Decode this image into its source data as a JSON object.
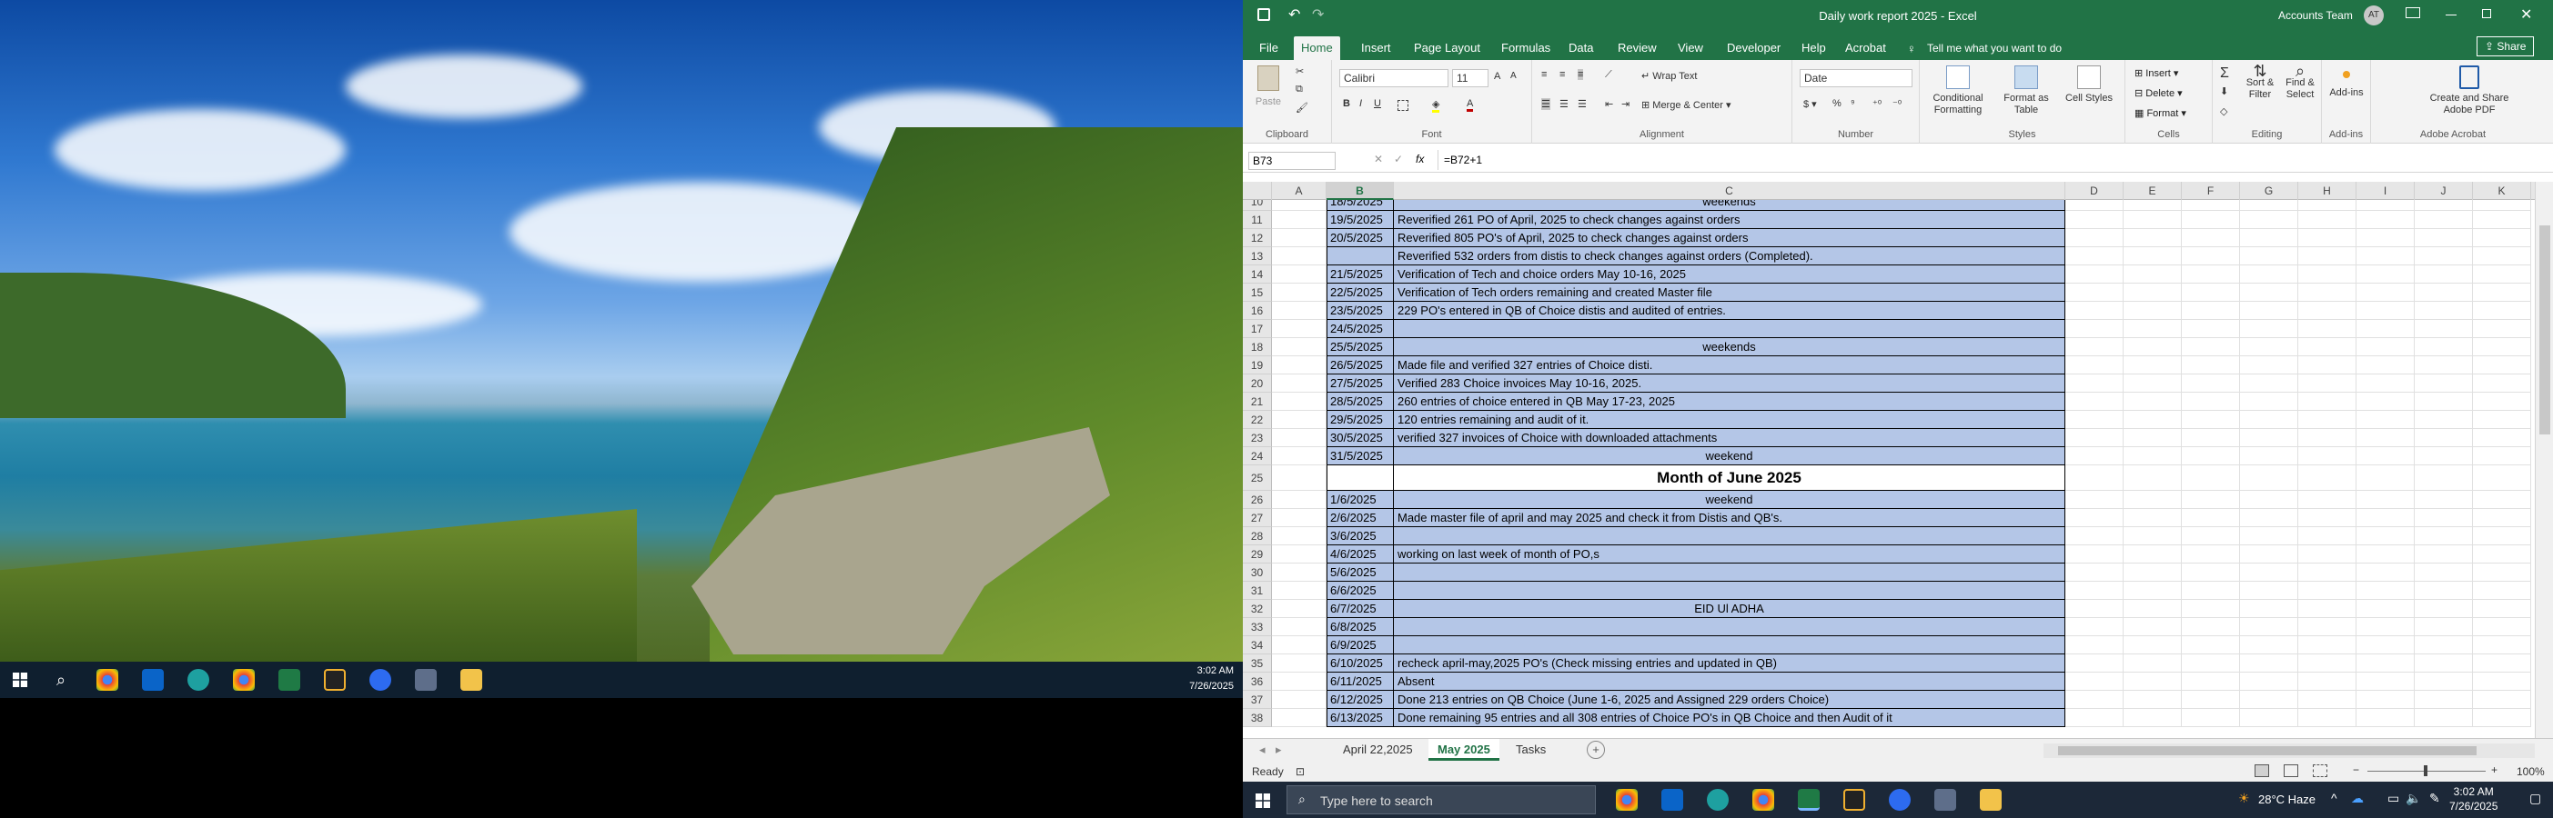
{
  "left_taskbar": {
    "time": "3:02 AM",
    "date": "7/26/2025"
  },
  "title_bar": {
    "doc_title": "Daily work report 2025  -  Excel",
    "user": "Accounts Team",
    "initials": "AT"
  },
  "ribbon_tabs": [
    "File",
    "Home",
    "Insert",
    "Page Layout",
    "Formulas",
    "Data",
    "Review",
    "View",
    "Developer",
    "Help",
    "Acrobat"
  ],
  "tell_me": "Tell me what you want to do",
  "share": "Share",
  "ribbon": {
    "clipboard": {
      "label": "Clipboard",
      "paste": "Paste"
    },
    "font": {
      "label": "Font",
      "name": "Calibri",
      "size": "11"
    },
    "alignment": {
      "label": "Alignment",
      "wrap": "Wrap Text",
      "merge": "Merge & Center"
    },
    "number": {
      "label": "Number",
      "format": "Date"
    },
    "styles": {
      "label": "Styles",
      "conditional": "Conditional Formatting",
      "format_table": "Format as Table",
      "cell_styles": "Cell Styles"
    },
    "cells": {
      "label": "Cells",
      "insert": "Insert",
      "delete": "Delete",
      "format": "Format"
    },
    "editing": {
      "label": "Editing",
      "sort": "Sort & Filter",
      "find": "Find & Select"
    },
    "addins": {
      "label": "Add-ins",
      "addins": "Add-ins"
    },
    "acrobat": {
      "label": "Adobe Acrobat",
      "create": "Create and Share Adobe PDF"
    }
  },
  "formula_bar": {
    "name_box": "B73",
    "fx": "fx",
    "formula": "=B72+1"
  },
  "columns": [
    "A",
    "B",
    "C",
    "D",
    "E",
    "F",
    "G",
    "H",
    "I",
    "J",
    "K"
  ],
  "rows": [
    {
      "n": "10",
      "date": "18/5/2025",
      "text": "weekends",
      "center": true
    },
    {
      "n": "11",
      "date": "19/5/2025",
      "text": "Reverified 261 PO of April, 2025 to check changes against orders"
    },
    {
      "n": "12",
      "date": "20/5/2025",
      "text": "Reverified 805 PO's of April, 2025 to check changes against orders"
    },
    {
      "n": "13",
      "date": "",
      "text": "Reverified 532 orders from distis to check changes against orders (Completed)."
    },
    {
      "n": "14",
      "date": "21/5/2025",
      "text": "Verification of Tech and choice orders May 10-16, 2025"
    },
    {
      "n": "15",
      "date": "22/5/2025",
      "text": "Verification of Tech orders remaining and created Master file"
    },
    {
      "n": "16",
      "date": "23/5/2025",
      "text": "229 PO's entered in QB of Choice distis and audited of entries."
    },
    {
      "n": "17",
      "date": "24/5/2025",
      "text": ""
    },
    {
      "n": "18",
      "date": "25/5/2025",
      "text": "weekends",
      "center": true
    },
    {
      "n": "19",
      "date": "26/5/2025",
      "text": "Made  file and verified  327  entries of Choice disti."
    },
    {
      "n": "20",
      "date": "27/5/2025",
      "text": "Verified 283  Choice invoices May 10-16, 2025."
    },
    {
      "n": "21",
      "date": "28/5/2025",
      "text": "260 entries of choice entered in QB May 17-23, 2025"
    },
    {
      "n": "22",
      "date": "29/5/2025",
      "text": "120 entries remaining and audit of it."
    },
    {
      "n": "23",
      "date": "30/5/2025",
      "text": "verified 327 invoices of Choice with downloaded attachments"
    },
    {
      "n": "24",
      "date": "31/5/2025",
      "text": "weekend",
      "center": true
    },
    {
      "n": "25",
      "date": "",
      "text": "Month of June 2025"
    },
    {
      "n": "26",
      "date": "1/6/2025",
      "text": "weekend",
      "center": true
    },
    {
      "n": "27",
      "date": "2/6/2025",
      "text": "Made master file of april and may 2025 and check it from Distis and QB's."
    },
    {
      "n": "28",
      "date": "3/6/2025",
      "text": ""
    },
    {
      "n": "29",
      "date": "4/6/2025",
      "text": "working on last week of month of PO,s"
    },
    {
      "n": "30",
      "date": "5/6/2025",
      "text": ""
    },
    {
      "n": "31",
      "date": "6/6/2025",
      "text": ""
    },
    {
      "n": "32",
      "date": "6/7/2025",
      "text": "EID Ul ADHA",
      "center": true
    },
    {
      "n": "33",
      "date": "6/8/2025",
      "text": ""
    },
    {
      "n": "34",
      "date": "6/9/2025",
      "text": ""
    },
    {
      "n": "35",
      "date": "6/10/2025",
      "text": "recheck april-may,2025 PO's (Check missing entries and updated in QB)"
    },
    {
      "n": "36",
      "date": "6/11/2025",
      "text": "Absent"
    },
    {
      "n": "37",
      "date": "6/12/2025",
      "text": "Done 213 entries on QB Choice (June 1-6, 2025 and Assigned 229 orders Choice)"
    },
    {
      "n": "38",
      "date": "6/13/2025",
      "text": "Done remaining 95 entries and all 308 entries  of Choice PO's in QB Choice and then Audit of it"
    }
  ],
  "sheet_tabs": [
    "April 22,2025",
    "May 2025",
    "Tasks"
  ],
  "active_sheet": "May 2025",
  "status": {
    "ready": "Ready",
    "zoom": "100%"
  },
  "right_taskbar": {
    "search": "Type here to search",
    "weather": "28°C  Haze",
    "time": "3:02 AM",
    "date": "7/26/2025"
  }
}
